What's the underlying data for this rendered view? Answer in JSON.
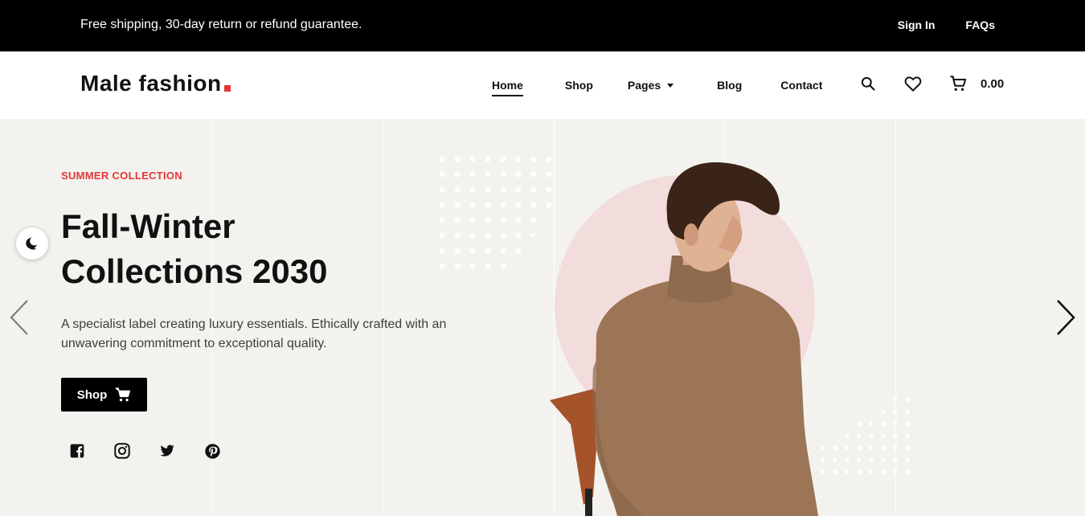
{
  "topbar": {
    "promo": "Free shipping, 30-day return or refund guarantee.",
    "links": [
      "Sign In",
      "FAQs"
    ]
  },
  "header": {
    "logo": "Male fashion",
    "nav": [
      {
        "label": "Home",
        "active": true
      },
      {
        "label": "Shop"
      },
      {
        "label": "Pages",
        "has_dropdown": true
      },
      {
        "label": "Blog"
      },
      {
        "label": "Contact"
      }
    ],
    "icons": [
      "search-icon",
      "heart-icon",
      "cart-icon"
    ],
    "cart_total": "0.00"
  },
  "hero": {
    "subtitle": "SUMMER COLLECTION",
    "title_line1": "Fall-Winter",
    "title_line2": "Collections 2030",
    "description": "A specialist label creating luxury essentials. Ethically crafted with an unwavering commitment to exceptional quality.",
    "shop_button": "Shop",
    "socials": [
      "facebook-icon",
      "instagram-icon",
      "twitter-icon",
      "pinterest-icon"
    ]
  },
  "colors": {
    "accent": "#e53637",
    "hero_bg": "#f3f2ee",
    "topbar_bg": "#000000",
    "circle": "#f2dcdc",
    "sweater": "#9b7556"
  }
}
